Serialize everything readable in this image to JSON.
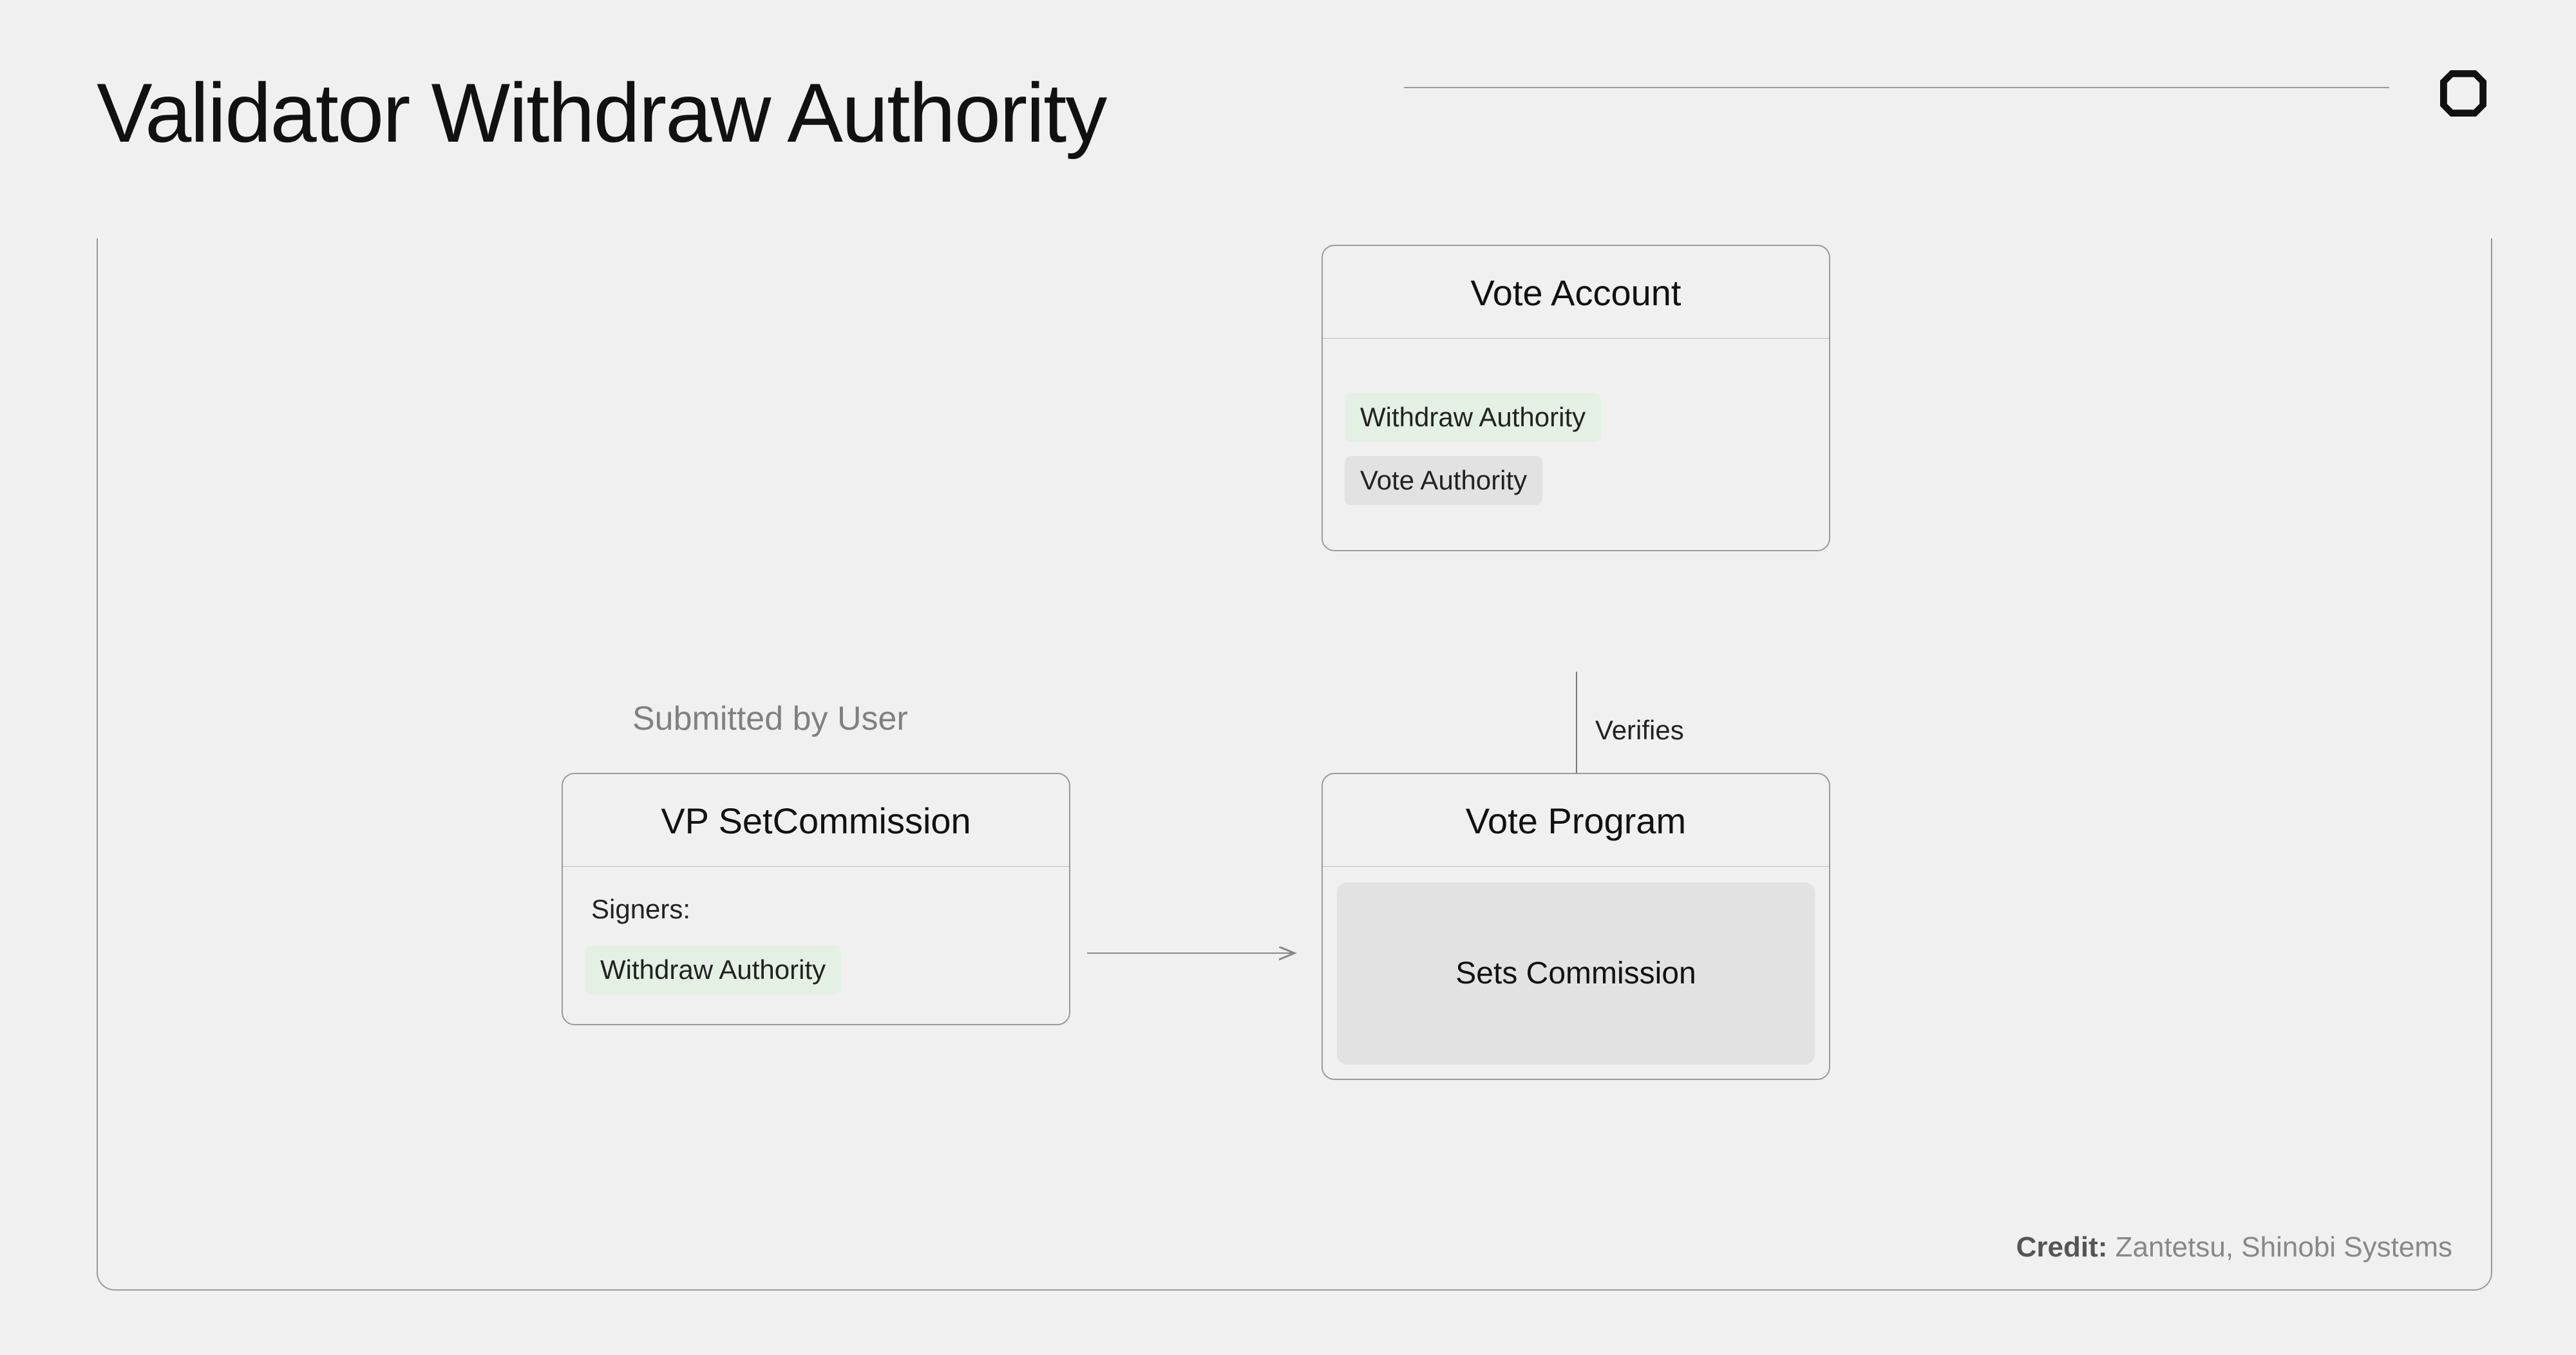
{
  "title": "Validator Withdraw Authority",
  "vote_account": {
    "title": "Vote Account",
    "withdraw_authority": "Withdraw Authority",
    "vote_authority": "Vote Authority"
  },
  "vp_setcommission": {
    "title": "VP SetCommission",
    "signers_label": "Signers:",
    "signer": "Withdraw Authority"
  },
  "vote_program": {
    "title": "Vote Program",
    "action": "Sets Commission"
  },
  "caption_submitted": "Submitted by User",
  "edge_verifies": "Verifies",
  "credit_label": "Credit:",
  "credit_value": "Zantetsu, Shinobi Systems"
}
